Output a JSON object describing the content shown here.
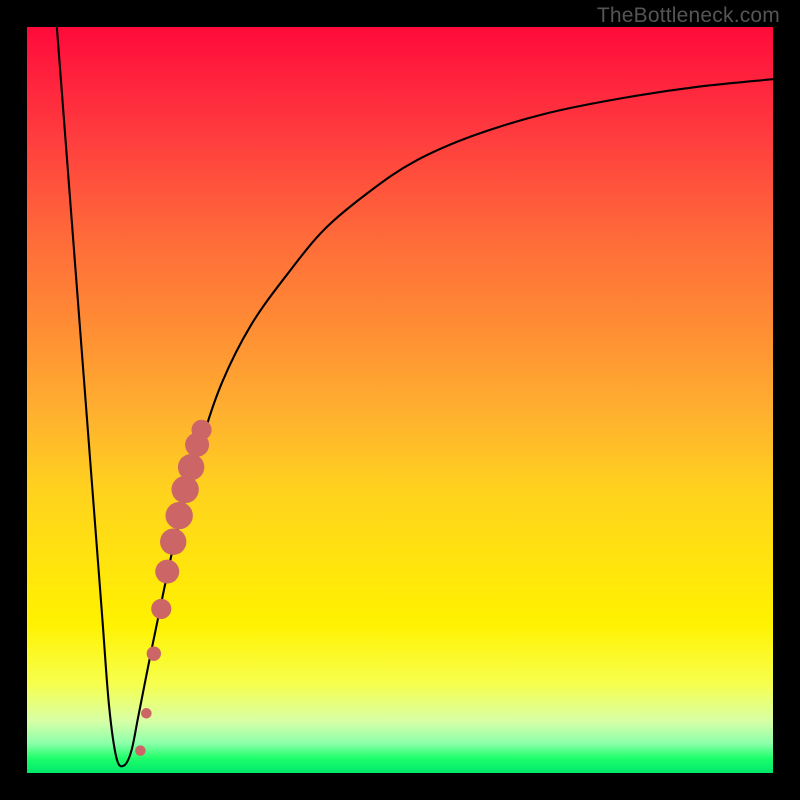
{
  "watermark": "TheBottleneck.com",
  "chart_data": {
    "type": "line",
    "title": "",
    "xlabel": "",
    "ylabel": "",
    "xlim": [
      0,
      100
    ],
    "ylim": [
      0,
      100
    ],
    "grid": false,
    "series": [
      {
        "name": "curve",
        "desc": "Sharp V falling from top-left to minimum near ~12% x, then asymptotic rise toward the right",
        "color": "#000000",
        "x": [
          4,
          6,
          8,
          10,
          11,
          12,
          13,
          14,
          15,
          17,
          20,
          23,
          26,
          30,
          35,
          40,
          46,
          52,
          60,
          70,
          80,
          90,
          100
        ],
        "y": [
          100,
          74,
          48,
          22,
          9,
          2,
          1,
          3,
          8,
          18,
          32,
          43,
          52,
          60,
          67,
          73,
          78,
          82,
          85.5,
          88.5,
          90.5,
          92,
          93
        ]
      }
    ],
    "points": {
      "name": "highlight-points",
      "desc": "Cluster of salmon dots on rising limb between roughly x=15–23",
      "color": "#cc6666",
      "x": [
        15.2,
        16.0,
        17.0,
        18.0,
        18.8,
        19.6,
        20.4,
        21.2,
        22.0,
        22.8,
        23.4
      ],
      "y": [
        3.0,
        8.0,
        16.0,
        22.0,
        27.0,
        31.0,
        34.5,
        38.0,
        41.0,
        44.0,
        46.0
      ],
      "r": [
        2.2,
        2.2,
        3.0,
        4.2,
        5.0,
        5.5,
        5.7,
        5.7,
        5.5,
        5.0,
        4.2
      ]
    }
  }
}
